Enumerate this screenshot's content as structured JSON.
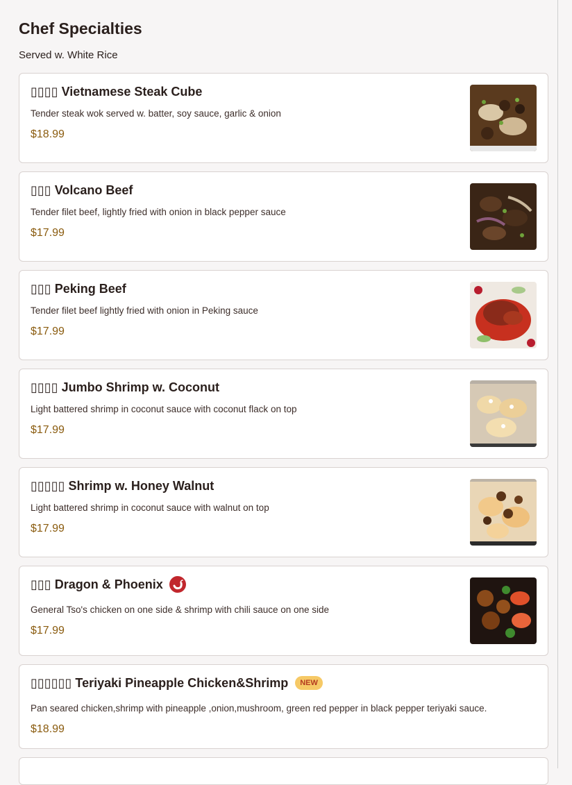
{
  "section": {
    "title": "Chef Specialties",
    "subtitle": "Served w. White Rice"
  },
  "items": [
    {
      "name": "▯▯▯▯ Vietnamese Steak Cube",
      "description": "Tender steak wok served w. batter, soy sauce, garlic & onion",
      "price": "$18.99",
      "image": "steak-cube-photo"
    },
    {
      "name": "▯▯▯ Volcano Beef",
      "description": "Tender filet beef, lightly fried with onion in black pepper sauce",
      "price": "$17.99",
      "image": "volcano-beef-photo"
    },
    {
      "name": "▯▯▯ Peking Beef",
      "description": "Tender filet beef lightly fried with onion in Peking sauce",
      "price": "$17.99",
      "image": "peking-beef-photo"
    },
    {
      "name": "▯▯▯▯ Jumbo Shrimp w. Coconut",
      "description": "Light battered shrimp in coconut sauce with coconut flack on top",
      "price": "$17.99",
      "image": "coconut-shrimp-photo"
    },
    {
      "name": "▯▯▯▯▯ Shrimp w. Honey Walnut",
      "description": "Light battered shrimp in coconut sauce with walnut on top",
      "price": "$17.99",
      "image": "walnut-shrimp-photo"
    },
    {
      "name": "▯▯▯ Dragon & Phoenix",
      "description": "General Tso's chicken on one side & shrimp with chili sauce on one side",
      "price": "$17.99",
      "image": "dragon-phoenix-photo",
      "badge_icon": "chili-pepper-icon"
    },
    {
      "name": "▯▯▯▯▯▯ Teriyaki Pineapple Chicken&Shrimp",
      "description": "Pan seared chicken,shrimp with pineapple ,onion,mushroom, green red pepper in black pepper teriyaki sauce.",
      "price": "$18.99",
      "badge": "NEW"
    }
  ],
  "colors": {
    "background": "#f7f5f5",
    "price": "#8a5b0e",
    "chili_badge": "#c1272d",
    "new_badge_bg": "#f6c966",
    "new_badge_text": "#b43b20"
  }
}
